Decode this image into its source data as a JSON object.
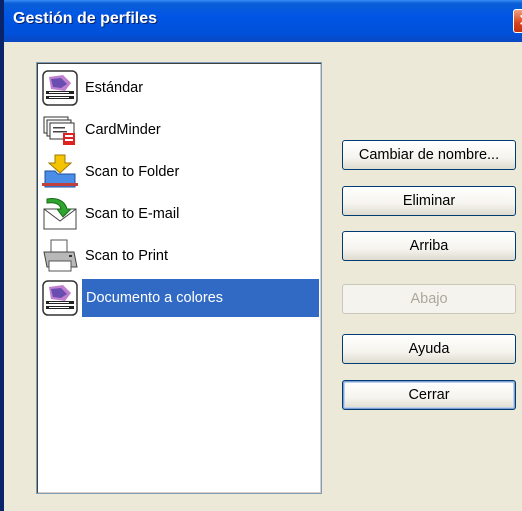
{
  "window": {
    "title": "Gestión de perfiles",
    "close_symbol": "✕"
  },
  "profiles": [
    {
      "label": "Estándar",
      "icon": "scansoft-organizer-icon",
      "selected": false
    },
    {
      "label": "CardMinder",
      "icon": "cardminder-icon",
      "selected": false
    },
    {
      "label": "Scan to Folder",
      "icon": "scan-to-folder-icon",
      "selected": false
    },
    {
      "label": "Scan to E-mail",
      "icon": "scan-to-email-icon",
      "selected": false
    },
    {
      "label": "Scan to Print",
      "icon": "scan-to-print-icon",
      "selected": false
    },
    {
      "label": "Documento a colores",
      "icon": "scansoft-organizer-icon",
      "selected": true
    }
  ],
  "buttons": {
    "rename": "Cambiar de nombre...",
    "delete": "Eliminar",
    "up": "Arriba",
    "down": "Abajo",
    "help": "Ayuda",
    "close": "Cerrar"
  },
  "colors": {
    "titlebar": "#0055e5",
    "selection": "#316ac5",
    "dialog_bg": "#ece9d8"
  }
}
